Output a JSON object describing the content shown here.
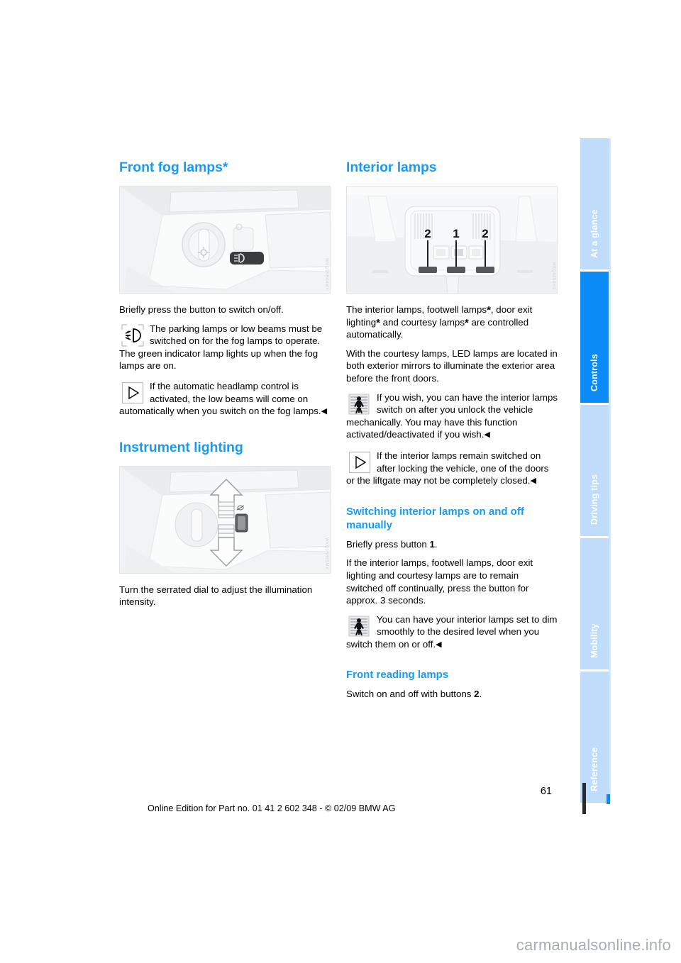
{
  "document": {
    "page_number": "61",
    "footer_line": "Online Edition for Part no. 01 41 2 602 348 - © 02/09 BMW AG",
    "watermark": "carmanualsonline.info"
  },
  "tabs": [
    {
      "label": "At a glance",
      "active": false
    },
    {
      "label": "Controls",
      "active": true
    },
    {
      "label": "Driving tips",
      "active": false
    },
    {
      "label": "Mobility",
      "active": false
    },
    {
      "label": "Reference",
      "active": false
    }
  ],
  "colors": {
    "heading_blue": "#169bf5",
    "tab_active": "#0b8bf5",
    "tab_inactive": "#bfdcfb",
    "figure_bg": "#f2f3f4"
  },
  "left_column": {
    "heading_fog": "Front fog lamps*",
    "figure_fog": {
      "alt": "Light switch panel with fog lamp button",
      "code": "WKQ3SB04MY"
    },
    "para_1": "Briefly press the button to switch on/off.",
    "note_1": {
      "icon": "fog-lamp-icon",
      "text": "The parking lamps or low beams must be switched on for the fog lamps to operate. The green indicator lamp lights up when the fog lamps are on."
    },
    "note_2": {
      "icon": "triangle-play-icon",
      "text": "If the automatic headlamp control is activated, the low beams will come on automatically when you switch on the fog lamps.",
      "endmark": "◀"
    },
    "heading_instrument": "Instrument lighting",
    "figure_instrument": {
      "alt": "Serrated dial for instrument illumination with up and down arrows",
      "code": "WKQ3SB05MY"
    },
    "para_2": "Turn the serrated dial to adjust the illumination intensity."
  },
  "right_column": {
    "heading_interior": "Interior lamps",
    "figure_interior": {
      "alt": "Overhead console with interior lamp buttons",
      "callouts": [
        "2",
        "1",
        "2"
      ],
      "code": "WKQ6250HS"
    },
    "para_1_parts": {
      "a": "The interior lamps, footwell lamps",
      "b": ", door exit lighting",
      "c": " and courtesy lamps",
      "d": " are controlled automatically."
    },
    "para_2": "With the courtesy lamps, LED lamps are located in both exterior mirrors to illuminate the exterior area before the front doors.",
    "note_1": {
      "icon": "person-vehicle-icon",
      "text": "If you wish, you can have the interior lamps switch on after you unlock the vehicle mechanically. You may have this function activated/deactivated if you wish.",
      "endmark": "◀"
    },
    "note_2": {
      "icon": "triangle-play-icon",
      "text": "If the interior lamps remain switched on after locking the vehicle, one of the doors or the liftgate may not be completely closed.",
      "endmark": "◀"
    },
    "subheading_switching": "Switching interior lamps on and off manually",
    "para_3_pre": "Briefly press button ",
    "para_3_bold": "1",
    "para_3_post": ".",
    "para_4": "If the interior lamps, footwell lamps, door exit lighting and courtesy lamps are to remain switched off continually, press the button for approx. 3 seconds.",
    "note_3": {
      "icon": "person-vehicle-icon",
      "text": "You can have your interior lamps set to dim smoothly to the desired level when you switch them on or off.",
      "endmark": "◀"
    },
    "subheading_reading": "Front reading lamps",
    "para_5_pre": "Switch on and off with buttons ",
    "para_5_bold": "2",
    "para_5_post": "."
  }
}
